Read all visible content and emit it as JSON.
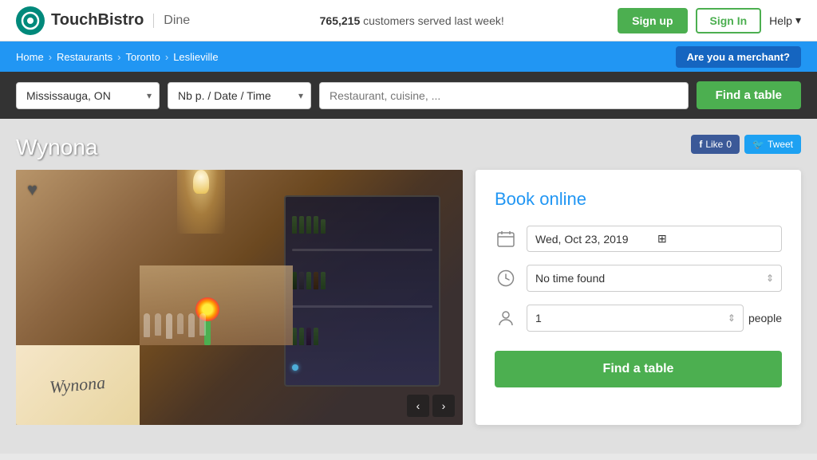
{
  "topnav": {
    "logo_text": "TouchBistro",
    "dine_label": "Dine",
    "stats_text": " customers served last week!",
    "stats_number": "765,215",
    "signup_label": "Sign up",
    "signin_label": "Sign In",
    "help_label": "Help"
  },
  "breadcrumb": {
    "home": "Home",
    "restaurants": "Restaurants",
    "city": "Toronto",
    "neighborhood": "Leslieville",
    "merchant_btn": "Are you a merchant?"
  },
  "searchbar": {
    "location_value": "Mississauga, ON",
    "date_placeholder": "Nb p. / Date / Time",
    "restaurant_placeholder": "Restaurant, cuisine, ...",
    "find_table_label": "Find a table"
  },
  "restaurant": {
    "name": "Wynona",
    "script_name": "Wynona"
  },
  "social": {
    "like_label": "Like",
    "like_count": "0",
    "tweet_label": "Tweet"
  },
  "booking": {
    "title": "Book online",
    "date_value": "Wed, Oct 23, 2019",
    "time_label": "No time found",
    "people_label": "people",
    "find_table_label": "Find a table",
    "date_icon": "📅",
    "time_icon": "🕐",
    "person_icon": "👤"
  },
  "photo": {
    "prev_arrow": "‹",
    "next_arrow": "›",
    "heart": "♥"
  }
}
